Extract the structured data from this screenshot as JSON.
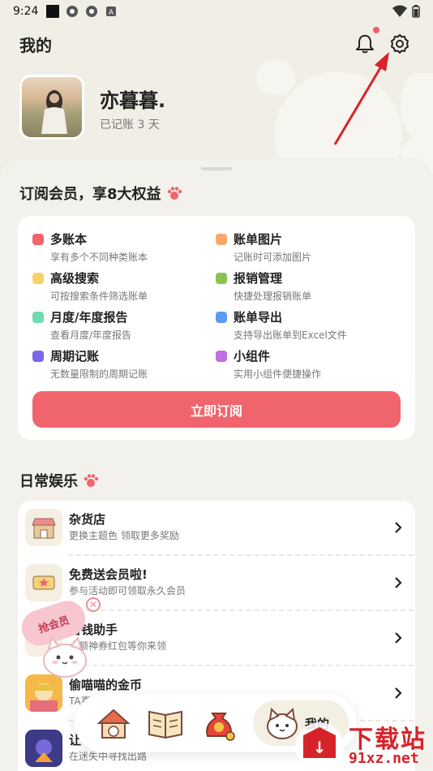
{
  "status_bar": {
    "time": "9:24"
  },
  "header": {
    "title": "我的"
  },
  "profile": {
    "username": "亦暮暮.",
    "days_text": "已记账 3 天"
  },
  "membership": {
    "title": "订阅会员，享8大权益",
    "benefits": [
      {
        "name": "多账本",
        "desc": "享有多个不同种类账本",
        "color": "#f4626d"
      },
      {
        "name": "账单图片",
        "desc": "记账时可添加图片",
        "color": "#f7a86a"
      },
      {
        "name": "高级搜索",
        "desc": "可按搜索条件筛选账单",
        "color": "#f7d26a"
      },
      {
        "name": "报销管理",
        "desc": "快捷处理报销账单",
        "color": "#8cc152"
      },
      {
        "name": "月度/年度报告",
        "desc": "查看月度/年度报告",
        "color": "#6fdcb0"
      },
      {
        "name": "账单导出",
        "desc": "支持导出账单到Excel文件",
        "color": "#5b9cf2"
      },
      {
        "name": "周期记账",
        "desc": "无数量限制的周期记账",
        "color": "#7b66e8"
      },
      {
        "name": "小组件",
        "desc": "实用小组件便捷操作",
        "color": "#c06ee0"
      }
    ],
    "subscribe_label": "立即订阅",
    "accent": "#f0656d"
  },
  "entertainment": {
    "title": "日常娱乐",
    "items": [
      {
        "title": "杂货店",
        "sub": "更换主题色 领取更多奖励",
        "icon": "shop-icon"
      },
      {
        "title": "免费送会员啦!",
        "sub": "参与活动即可领取永久会员",
        "icon": "ticket-icon"
      },
      {
        "title": "省钱助手",
        "sub": "大额神券红包等你来领",
        "icon": "coupon-icon"
      },
      {
        "title": "偷喵喵的金币",
        "sub": "TA喜",
        "icon": "game-coin-icon"
      },
      {
        "title": "让",
        "sub": "在迷失中寻找出路",
        "icon": "game-maze-icon"
      }
    ]
  },
  "promo": {
    "badge_text": "抢会员"
  },
  "bottom_nav": {
    "items": [
      {
        "name": "home",
        "icon": "house-icon"
      },
      {
        "name": "ledger",
        "icon": "book-icon"
      },
      {
        "name": "wallet",
        "icon": "money-bag-icon"
      },
      {
        "name": "mine",
        "icon": "cat-icon",
        "label": "我的"
      }
    ]
  },
  "watermark": {
    "text": "下载站",
    "url": "91xz.net"
  }
}
